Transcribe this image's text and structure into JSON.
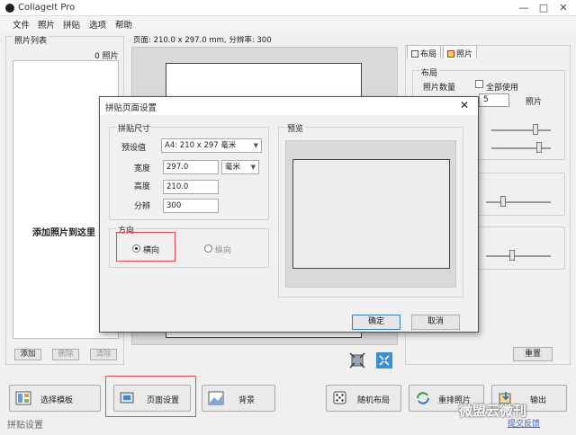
{
  "app": {
    "title": "CollageIt Pro",
    "menu": [
      "文件",
      "照片",
      "拼贴",
      "选项",
      "帮助"
    ]
  },
  "photo_list": {
    "title": "照片列表",
    "count": "0 照片",
    "hint": "添加照片到这里",
    "add_label": "添加",
    "remove_label": "删除",
    "clear_label": "清除"
  },
  "canvas": {
    "page_info": "页面: 210.0 x 297.0 mm, 分辨率: 300"
  },
  "right_panel": {
    "tabs": [
      "布局",
      "照片"
    ],
    "layout_title": "布局",
    "photo_qty_label": "照片数量",
    "all_use_label": "全部使用",
    "qty_value": "5",
    "qty_unit": "照片",
    "reset_label": "重置"
  },
  "toolbar": {
    "choose_template": "选择模板",
    "page_setup": "页面设置",
    "background": "背景",
    "random_layout": "随机布局",
    "shuffle_photos": "重排照片",
    "output": "输出"
  },
  "status": {
    "left_text": "拼贴设置",
    "watermark": "微盟云微刊",
    "feedback": "提交反馈"
  },
  "dialog": {
    "title": "拼贴页面设置",
    "size_group": "拼贴尺寸",
    "preset_label": "预设值",
    "preset_value": "A4: 210 x 297 毫米",
    "width_label": "宽度",
    "width_value": "297.0",
    "unit_value": "毫米",
    "height_label": "高度",
    "height_value": "210.0",
    "resolution_label": "分辨",
    "resolution_value": "300",
    "orientation_group": "方向",
    "landscape_label": "横向",
    "portrait_label": "纵向",
    "preview_group": "预览",
    "ok_label": "确定",
    "cancel_label": "取消"
  },
  "colors": {
    "highlight": "#e05050",
    "link": "#3a5fc8"
  }
}
